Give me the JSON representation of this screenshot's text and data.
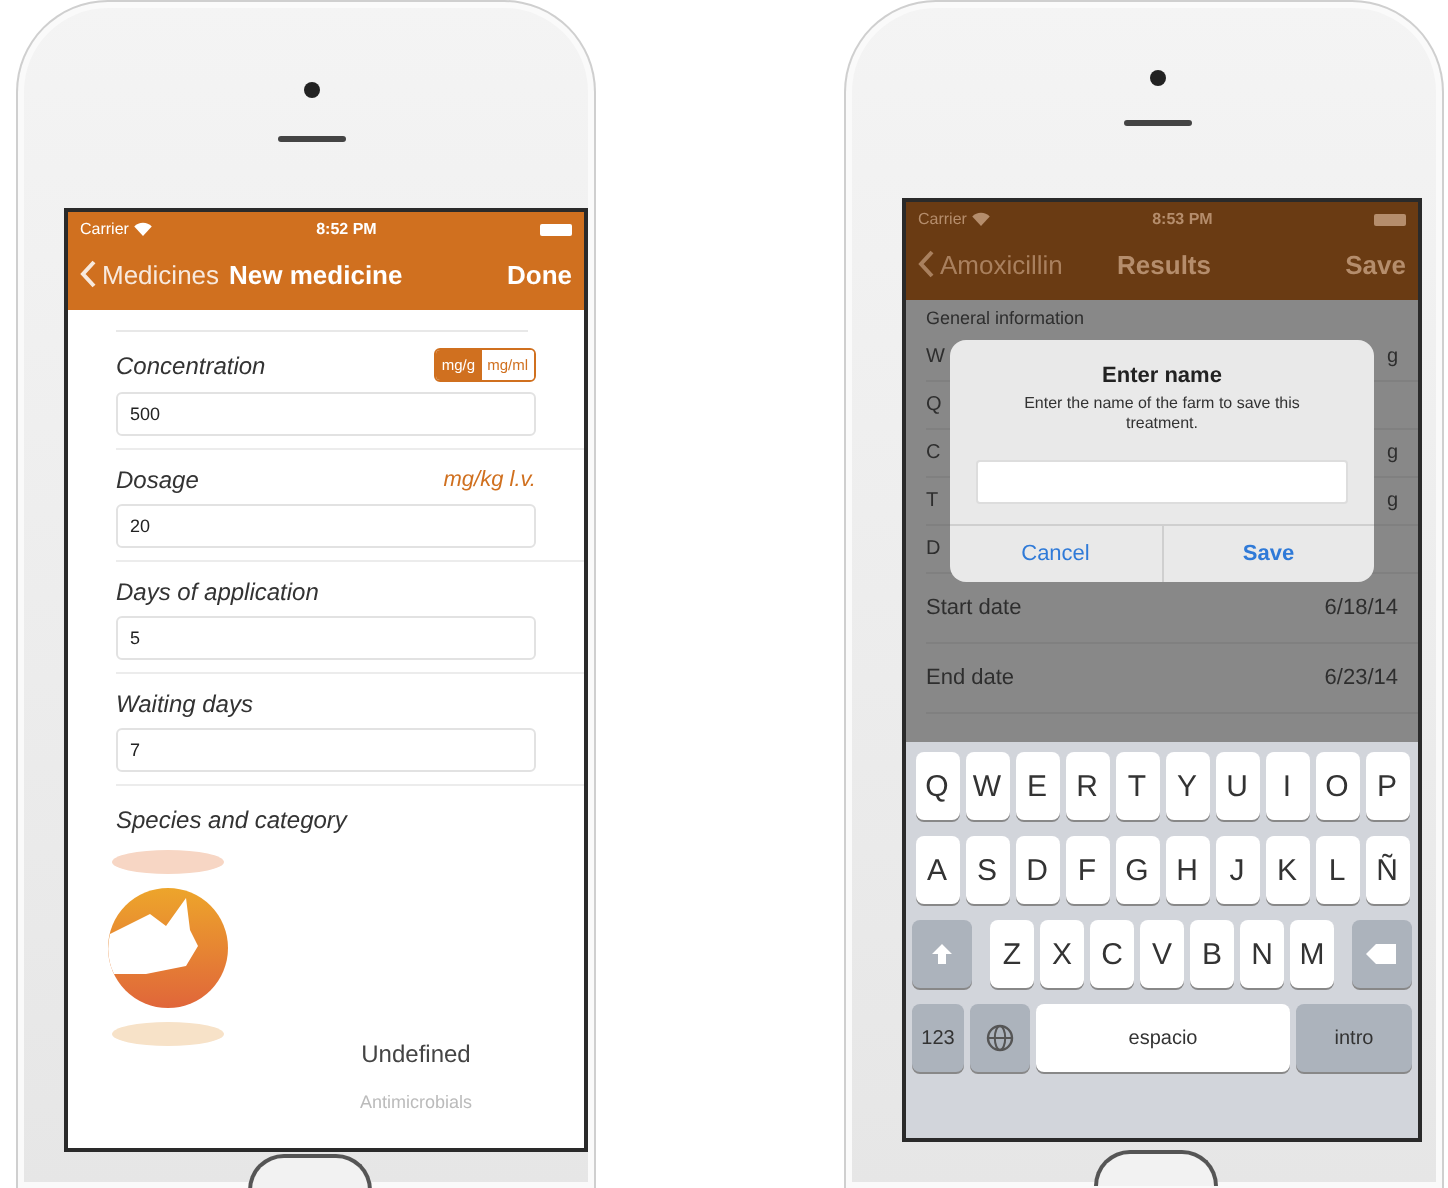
{
  "left_phone": {
    "status_bar": {
      "carrier": "Carrier",
      "time": "8:52 PM"
    },
    "nav": {
      "back": "Medicines",
      "title": "New medicine",
      "action": "Done"
    },
    "fields": [
      {
        "label": "Concentration",
        "value": "500",
        "units": [
          {
            "label": "mg/g",
            "selected": true
          },
          {
            "label": "mg/ml",
            "selected": false
          }
        ]
      },
      {
        "label": "Dosage",
        "unit_text": "mg/kg l.v.",
        "value": "20"
      },
      {
        "label": "Days of application",
        "value": "5"
      },
      {
        "label": "Waiting days",
        "value": "7"
      }
    ],
    "section": "Species and category",
    "picker": {
      "options": [
        "Undefined",
        "Antimicrobials"
      ]
    }
  },
  "right_phone": {
    "status_bar": {
      "carrier": "Carrier",
      "time": "8:53 PM"
    },
    "nav": {
      "back": "Amoxicillin",
      "title": "Results",
      "action": "Save"
    },
    "section": "General information",
    "rows": [
      {
        "label": "W",
        "value": "g"
      },
      {
        "label": "Q"
      },
      {
        "label": "C",
        "value": "g"
      },
      {
        "label": "T",
        "value": "g"
      },
      {
        "label": "D"
      },
      {
        "label": "Start date",
        "value": "6/18/14"
      },
      {
        "label": "End date",
        "value": "6/23/14"
      }
    ],
    "alert": {
      "title": "Enter name",
      "message": "Enter the name of the farm to save this treatment.",
      "buttons": [
        "Cancel",
        "Save"
      ]
    },
    "keyboard": {
      "rows": [
        [
          "Q",
          "W",
          "E",
          "R",
          "T",
          "Y",
          "U",
          "I",
          "O",
          "P"
        ],
        [
          "A",
          "S",
          "D",
          "F",
          "G",
          "H",
          "J",
          "K",
          "L",
          "Ñ"
        ],
        [
          "Z",
          "X",
          "C",
          "V",
          "B",
          "N",
          "M"
        ]
      ],
      "numbers": "123",
      "space": "espacio",
      "return": "intro"
    }
  }
}
